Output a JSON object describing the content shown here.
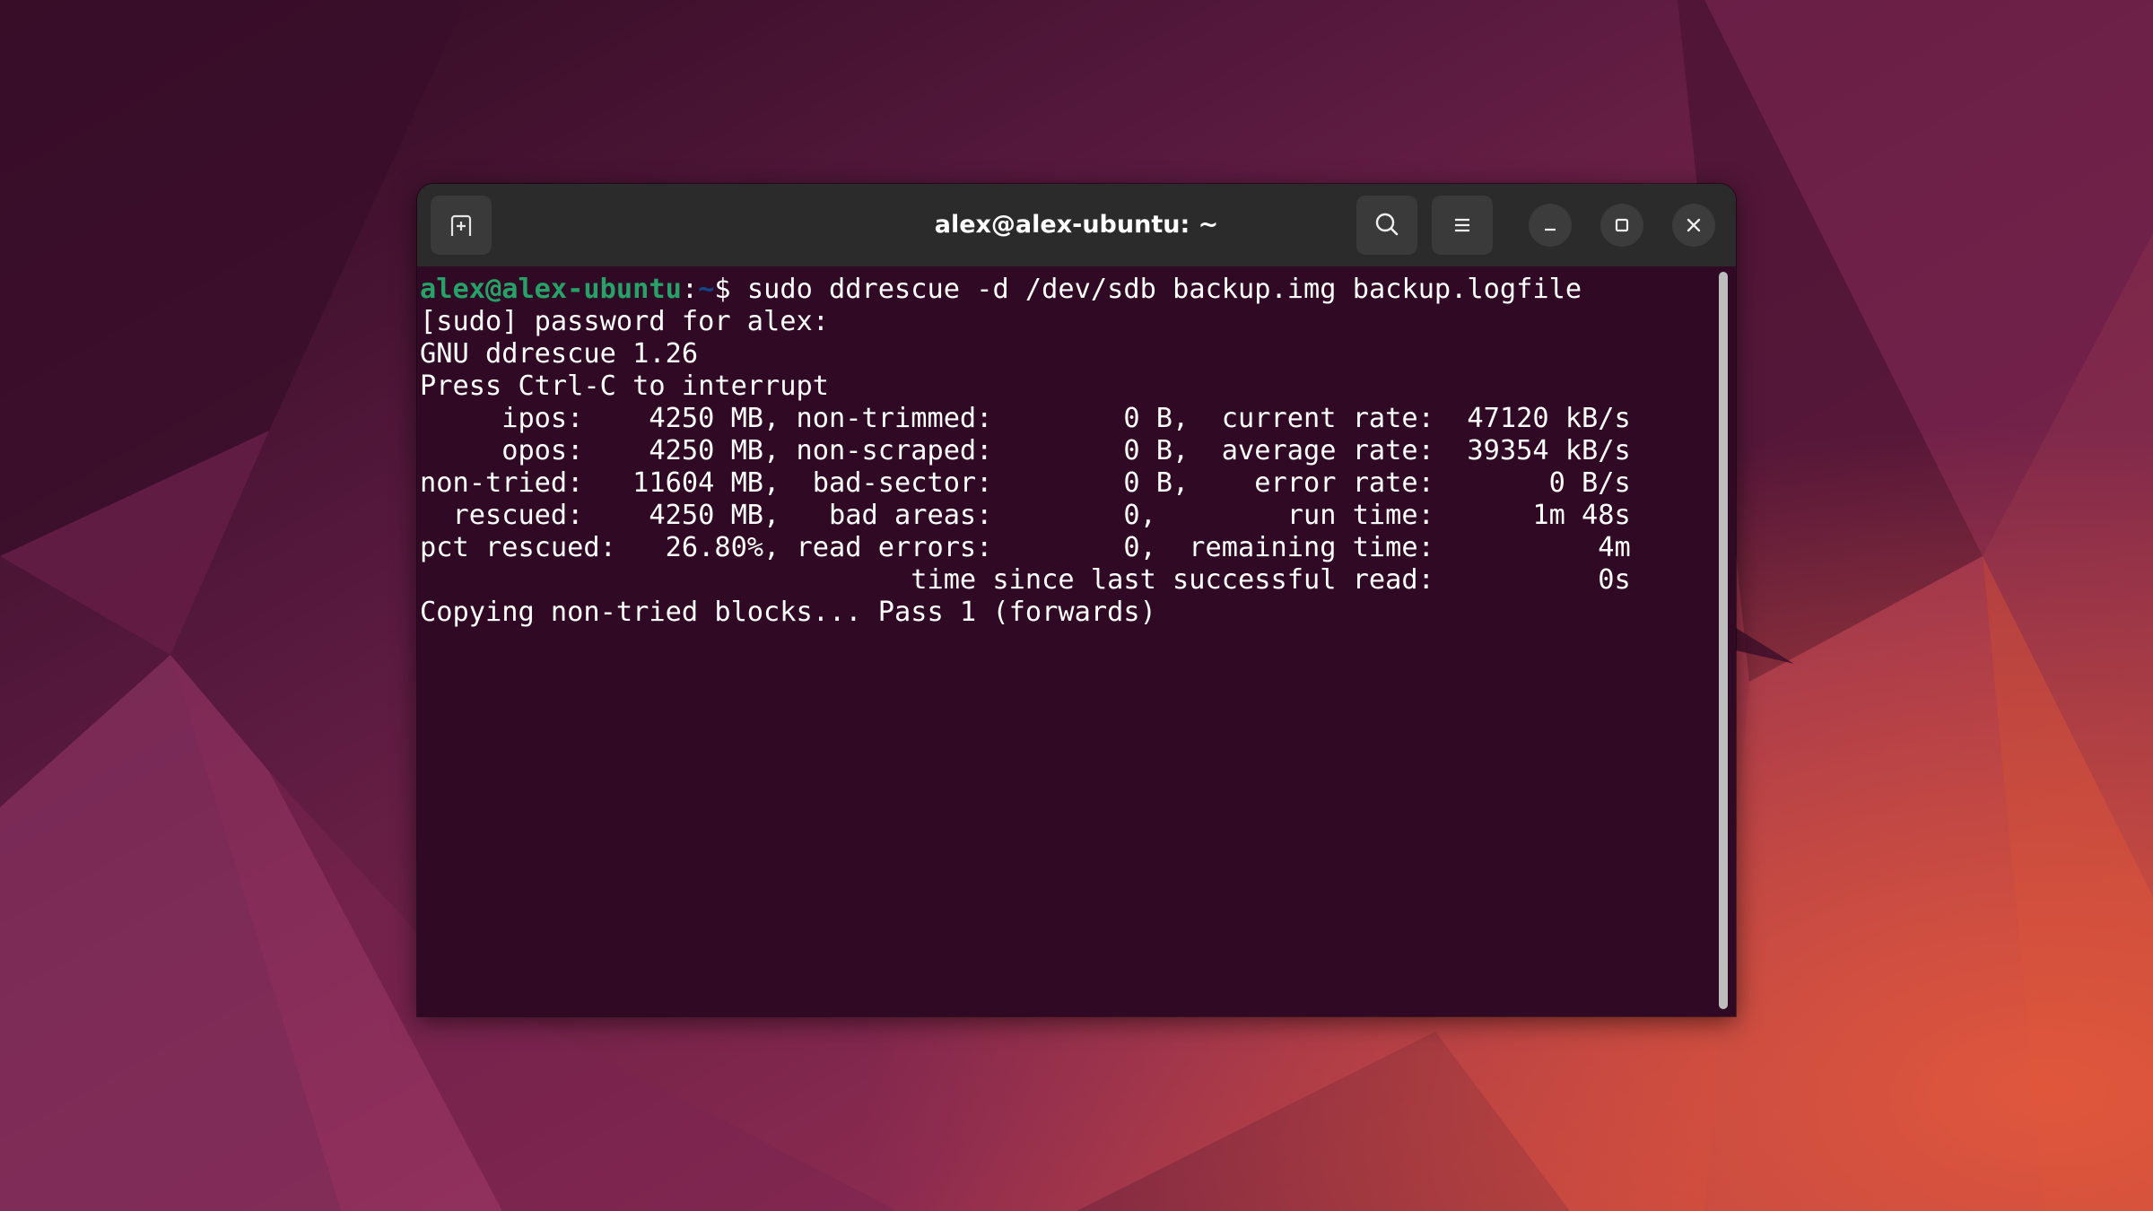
{
  "colors": {
    "terminal_bg": "#300a24",
    "headerbar_bg": "#2b2b2b",
    "prompt_user": "#26a269",
    "prompt_path": "#12488b",
    "text": "#ffffff"
  },
  "window": {
    "title": "alex@alex-ubuntu: ~",
    "buttons": {
      "new_tab_icon": "new-tab-icon",
      "search_icon": "search-icon",
      "menu_icon": "hamburger-menu-icon",
      "minimize_icon": "minimize-icon",
      "maximize_icon": "maximize-icon",
      "close_icon": "close-icon"
    }
  },
  "terminal": {
    "prompt": {
      "user_host": "alex@alex-ubuntu",
      "separator": ":",
      "path": "~",
      "symbol": "$ ",
      "command": "sudo ddrescue -d /dev/sdb backup.img backup.logfile"
    },
    "output": [
      "[sudo] password for alex:",
      "GNU ddrescue 1.26",
      "Press Ctrl-C to interrupt",
      "     ipos:    4250 MB, non-trimmed:        0 B,  current rate:  47120 kB/s",
      "     opos:    4250 MB, non-scraped:        0 B,  average rate:  39354 kB/s",
      "non-tried:   11604 MB,  bad-sector:        0 B,    error rate:       0 B/s",
      "  rescued:    4250 MB,   bad areas:        0,        run time:      1m 48s",
      "pct rescued:   26.80%, read errors:        0,  remaining time:          4m",
      "                              time since last successful read:          0s",
      "Copying non-tried blocks... Pass 1 (forwards)"
    ]
  }
}
